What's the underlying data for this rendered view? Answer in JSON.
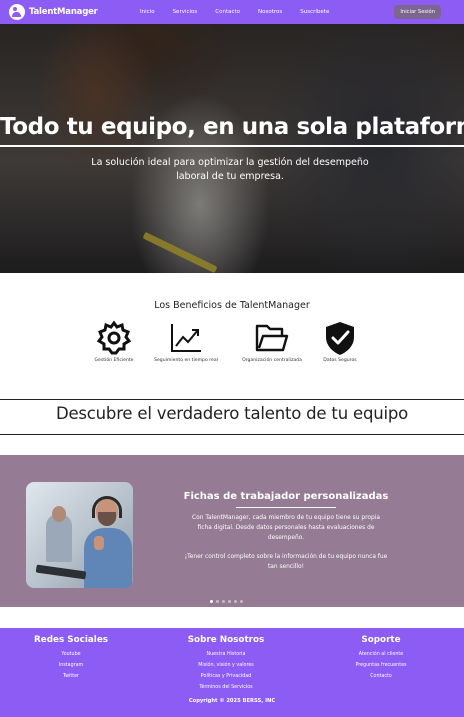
{
  "nav": {
    "logo_text": "TalentManager",
    "links": [
      "Inicio",
      "Servicios",
      "Contacto",
      "Nosotros",
      "Suscríbete"
    ],
    "login_label": "Iniciar Sesión"
  },
  "hero": {
    "title": "Todo tu equipo, en una sola plataforma",
    "subtitle": "La solución ideal para optimizar la gestión del desempeño laboral de tu empresa."
  },
  "benefits": {
    "title": "Los Beneficios de TalentManager",
    "items": [
      {
        "label": "Gestión Eficiente",
        "icon": "gear-icon"
      },
      {
        "label": "Seguimiento en tiempo real",
        "icon": "trend-chart-icon"
      },
      {
        "label": "Organización centralizada",
        "icon": "folder-icon"
      },
      {
        "label": "Datos Seguros",
        "icon": "shield-check-icon"
      }
    ]
  },
  "discover": {
    "title": "Descubre el verdadero talento de tu equipo"
  },
  "feature": {
    "title": "Fichas de trabajador personalizadas",
    "paragraph1": "Con TalentManager, cada miembro de tu equipo tiene su propia ficha digital. Desde datos personales hasta evaluaciones de desempeño.",
    "paragraph2": "¡Tener control completo sobre la información de tu equipo nunca fue tan sencillo!",
    "slides_total": 6,
    "active_slide": 0
  },
  "footer": {
    "social": {
      "title": "Redes Sociales",
      "items": [
        "Youtube",
        "Instagram",
        "Twitter"
      ]
    },
    "about": {
      "title": "Sobre Nosotros",
      "items": [
        "Nuestra Historia",
        "Misión, visión y valores",
        "Políticas y Privacidad",
        "Términos del Servicios"
      ]
    },
    "support": {
      "title": "Soporte",
      "items": [
        "Atención al cliente",
        "Preguntas frecuentes",
        "Contacto"
      ]
    },
    "copyright": "Copyright © 2025 BERSS, INC"
  },
  "colors": {
    "brand_purple": "#8c5cf5",
    "feature_bg": "#957b93",
    "login_button": "#7c6690"
  }
}
